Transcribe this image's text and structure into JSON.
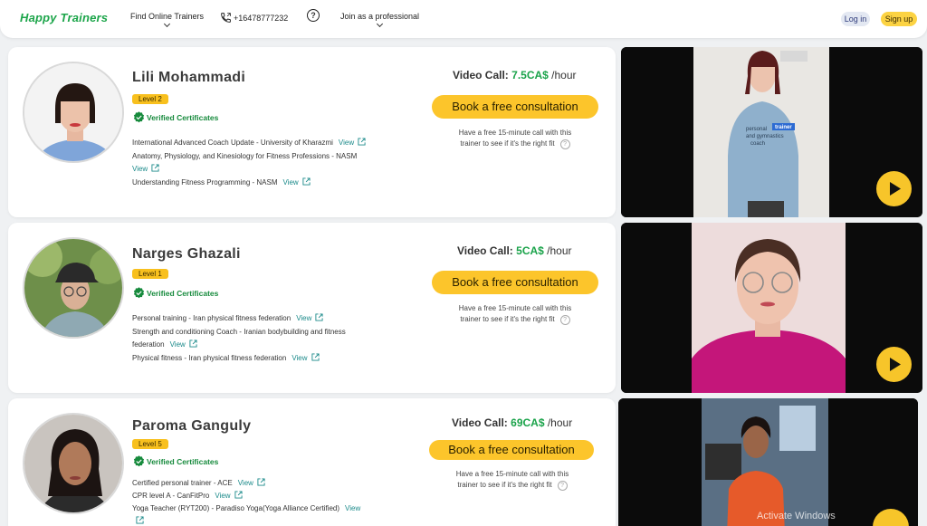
{
  "header": {
    "logo": "Happy Trainers",
    "nav_find": "Find Online Trainers",
    "phone": "+16478777232",
    "help": "?",
    "nav_join": "Join as a professional",
    "login": "Log in",
    "signup": "Sign up"
  },
  "colors": {
    "brand": "#1ca54a",
    "accent": "#fcc52b",
    "verified": "#168a3c",
    "link": "#1b8a8a"
  },
  "labels": {
    "video_call": "Video Call:",
    "per_hour": "/hour",
    "book": "Book a free consultation",
    "note_line1": "Have a free 15-minute call with this",
    "note_line2": "trainer to see if it's the right fit",
    "verified": "Verified Certificates",
    "view": "View"
  },
  "trainers": [
    {
      "name": "Lili Mohammadi",
      "level": "Level 2",
      "price": "7.5CA$",
      "certs": [
        "International Advanced Coach Update - University of Kharazmi",
        "Anatomy, Physiology, and Kinesiology for Fitness Professions - NASM",
        "Understanding Fitness Programming - NASM"
      ],
      "video_shirt_text": "personal trainer and gymnastics coach"
    },
    {
      "name": "Narges Ghazali",
      "level": "Level 1",
      "price": "5CA$",
      "certs": [
        "Personal training - Iran physical fitness federation",
        "Strength and conditioning Coach - Iranian bodybuilding and fitness federation",
        "Physical fitness - Iran physical fitness federation"
      ]
    },
    {
      "name": "Paroma Ganguly",
      "level": "Level 5",
      "price": "69CA$",
      "certs": [
        "Certified personal trainer - ACE",
        "CPR level A - CanFitPro",
        "Yoga Teacher (RYT200) - Paradiso Yoga(Yoga Alliance Certified)"
      ]
    }
  ],
  "watermark": "Activate Windows"
}
